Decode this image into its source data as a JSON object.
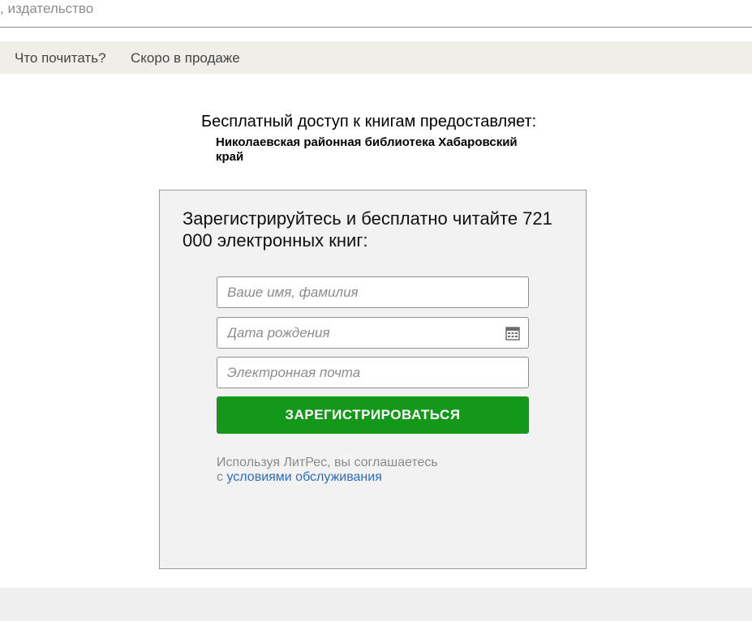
{
  "search": {
    "partial_placeholder": ", издательство"
  },
  "nav": {
    "items": [
      {
        "label": "Что почитать?"
      },
      {
        "label": "Скоро в продаже"
      }
    ]
  },
  "access": {
    "title": "Бесплатный доступ к книгам предоставляет:",
    "library": "Николаевская районная библиотека Хабаровский край"
  },
  "register": {
    "heading": "Зарегистрируйтесь и бесплатно читайте 721 000 электронных книг:",
    "name_placeholder": "Ваше имя, фамилия",
    "birth_placeholder": "Дата рождения",
    "email_placeholder": "Электронная почта",
    "submit_label": "ЗАРЕГИСТРИРОВАТЬСЯ",
    "terms_text_line1": "Используя ЛитРес, вы соглашаетесь",
    "terms_text_prefix": "с",
    "terms_link": "условиями обслуживания"
  },
  "colors": {
    "button": "#14981a",
    "link": "#2b6cc4",
    "nav_bg": "#efeee9"
  },
  "icons": {
    "calendar": "calendar-icon"
  }
}
